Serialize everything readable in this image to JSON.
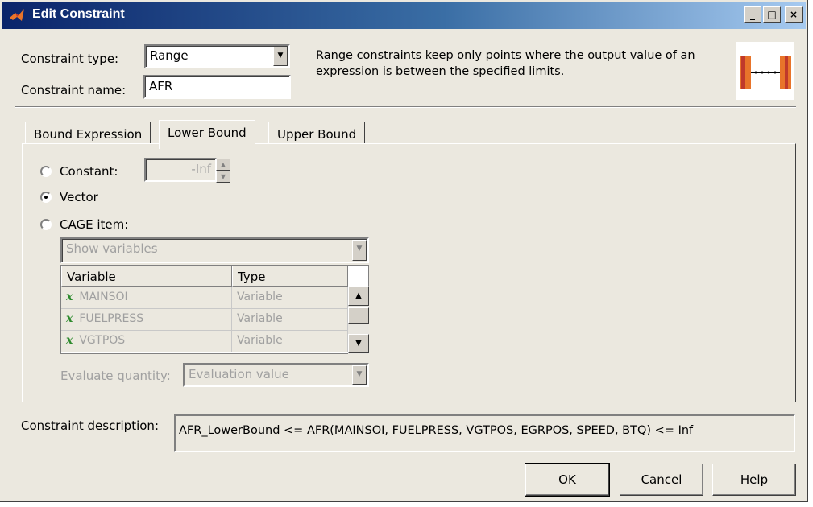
{
  "window": {
    "title": "Edit Constraint"
  },
  "titlebar_buttons": {
    "minimize": "_",
    "maximize": "□",
    "close": "×"
  },
  "header": {
    "type_label": "Constraint type:",
    "type_value": "Range",
    "name_label": "Constraint name:",
    "name_value": "AFR",
    "description": "Range constraints keep only points where the output value of an expression is between the specified limits."
  },
  "tabs": [
    {
      "label": "Bound Expression"
    },
    {
      "label": "Lower Bound"
    },
    {
      "label": "Upper Bound"
    }
  ],
  "lower_bound": {
    "constant_label": "Constant:",
    "constant_value": "-Inf",
    "vector_label": "Vector",
    "cage_label": "CAGE item:",
    "show_select": "Show variables",
    "columns": [
      "Variable",
      "Type"
    ],
    "rows": [
      {
        "icon": "x",
        "name": "MAINSOI",
        "type": "Variable"
      },
      {
        "icon": "x",
        "name": "FUELPRESS",
        "type": "Variable"
      },
      {
        "icon": "x",
        "name": "VGTPOS",
        "type": "Variable"
      }
    ],
    "evaluate_label": "Evaluate quantity:",
    "evaluate_value": "Evaluation value"
  },
  "footer": {
    "desc_label": "Constraint description:",
    "desc_value": "AFR_LowerBound <= AFR(MAINSOI, FUELPRESS, VGTPOS, EGRPOS, SPEED, BTQ) <= Inf",
    "ok": "OK",
    "cancel": "Cancel",
    "help": "Help"
  },
  "colors": {
    "title_start": "#0a246a",
    "title_end": "#a6caf0",
    "face": "#ebe8df",
    "accent": "#e8742a"
  }
}
